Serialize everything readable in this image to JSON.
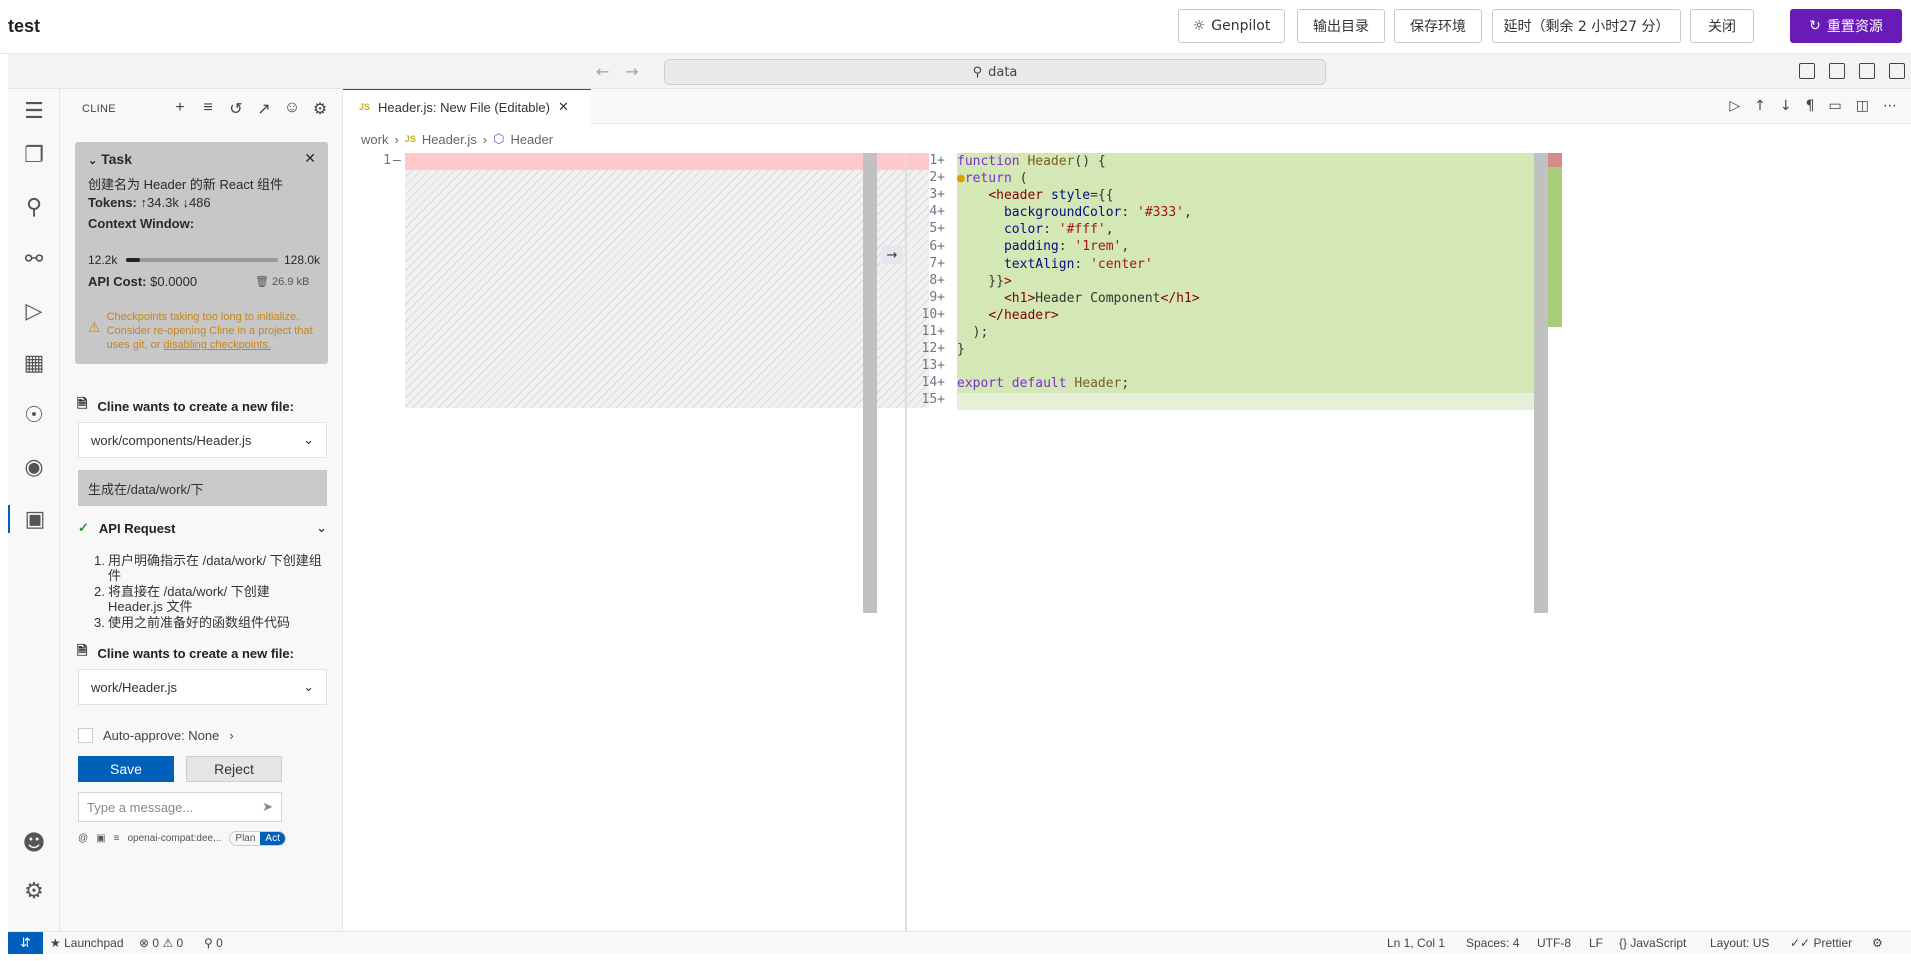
{
  "app": {
    "title": "test"
  },
  "topbar": {
    "genpilot": "Genpilot",
    "output_dir": "输出目录",
    "save_env": "保存环境",
    "extend": "延时（剩余 2 小时27 分）",
    "close": "关闭",
    "reset": "重置资源"
  },
  "titlebar": {
    "search": "data"
  },
  "sidebar": {
    "title": "CLINE",
    "task": {
      "heading": "Task",
      "description": "创建名为 Header 的新 React 组件",
      "tokens_label": "Tokens:",
      "tokens_up": "34.3k",
      "tokens_down": "486",
      "context_label": "Context Window:",
      "context_used": "12.2k",
      "context_max": "128.0k",
      "context_fraction": 0.095,
      "api_cost_label": "API Cost:",
      "api_cost": "$0.0000",
      "size": "26.9 kB",
      "warning_text": "Checkpoints taking too long to initialize. Consider re-opening Cline in a project that uses git, or ",
      "warning_link": "disabling checkpoints."
    },
    "create_file_1": {
      "title": "Cline wants to create a new file:",
      "path": "work/components/Header.js"
    },
    "user_msg": "生成在/data/work/下",
    "api_request": {
      "title": "API Request",
      "items": [
        "用户明确指示在 /data/work/ 下创建组件",
        "将直接在 /data/work/ 下创建 Header.js 文件",
        "使用之前准备好的函数组件代码"
      ]
    },
    "create_file_2": {
      "title": "Cline wants to create a new file:",
      "path": "work/Header.js"
    },
    "auto_approve": "Auto-approve: None",
    "save": "Save",
    "reject": "Reject",
    "message_placeholder": "Type a message...",
    "model": "openai-compat:dee...",
    "plan": "Plan",
    "act": "Act"
  },
  "editor": {
    "tab_label": "Header.js: New File (Editable)",
    "breadcrumb": [
      "work",
      "Header.js",
      "Header"
    ],
    "left_line": "1",
    "right_lines": [
      "1",
      "2",
      "3",
      "4",
      "5",
      "6",
      "7",
      "8",
      "9",
      "10",
      "11",
      "12",
      "13",
      "14",
      "15"
    ]
  },
  "statusbar": {
    "launchpad": "Launchpad",
    "errors": "0",
    "warnings": "0",
    "ports": "0",
    "cursor": "Ln 1, Col 1",
    "spaces": "Spaces: 4",
    "encoding": "UTF-8",
    "eol": "LF",
    "language": "JavaScript",
    "layout": "Layout: US",
    "prettier": "Prettier"
  },
  "colors": {
    "accent": "#005fb8",
    "reset_button": "#6a1ab7",
    "added_bg": "#d4e8b5",
    "removed_bg": "#ffc9c9"
  }
}
